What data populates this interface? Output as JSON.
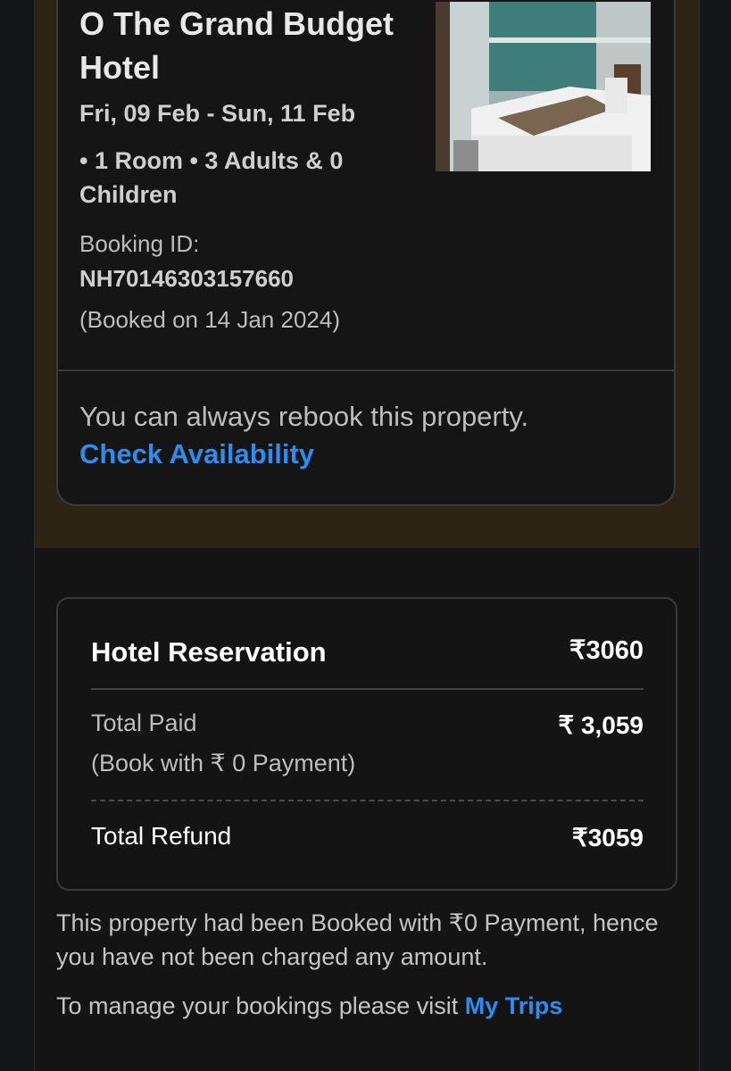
{
  "booking": {
    "hotel_name": "O The Grand Budget Hotel",
    "dates": "Fri, 09 Feb - Sun, 11 Feb",
    "guests": "• 1 Room • 3 Adults & 0 Children",
    "booking_id_label": "Booking ID:",
    "booking_id": "NH70146303157660",
    "booked_on": "(Booked on 14 Jan 2024)",
    "rebook_text": "You can always rebook this property.",
    "check_availability": "Check Availability"
  },
  "price": {
    "title": "Hotel Reservation",
    "title_amount": "₹3060",
    "paid_label": "Total Paid",
    "paid_amount": "₹ 3,059",
    "paid_note": "(Book with ₹ 0 Payment)",
    "refund_label": "Total Refund",
    "refund_amount": "₹3059"
  },
  "footer": {
    "note": "This property had been Booked with ₹0 Payment, hence you have not been charged any amount.",
    "manage_prefix": "To manage your bookings please visit ",
    "my_trips": "My Trips"
  },
  "colors": {
    "background": "#15161a",
    "top_band": "#2e2413",
    "link": "#2e8cf0"
  }
}
